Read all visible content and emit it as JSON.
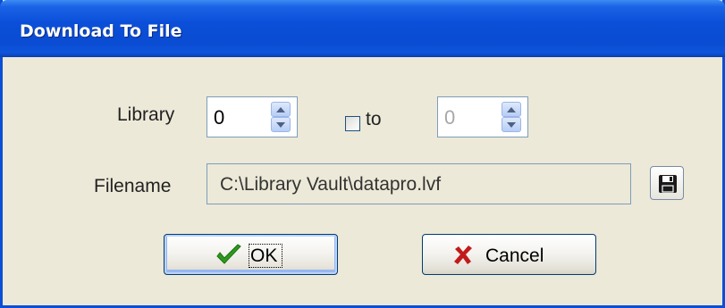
{
  "window": {
    "title": "Download To File"
  },
  "library": {
    "label": "Library",
    "from_value": "0",
    "to_label": "to",
    "to_checked": false,
    "to_value": "0"
  },
  "filename": {
    "label": "Filename",
    "value": "C:\\Library Vault\\datapro.lvf",
    "save_icon": "floppy-disk-icon"
  },
  "buttons": {
    "ok_label": "OK",
    "ok_icon": "checkmark-icon",
    "cancel_label": "Cancel",
    "cancel_icon": "x-icon"
  },
  "colors": {
    "titlebar": "#0a4cd2",
    "ok_check": "#2e9a1f",
    "cancel_x": "#c2191b"
  }
}
